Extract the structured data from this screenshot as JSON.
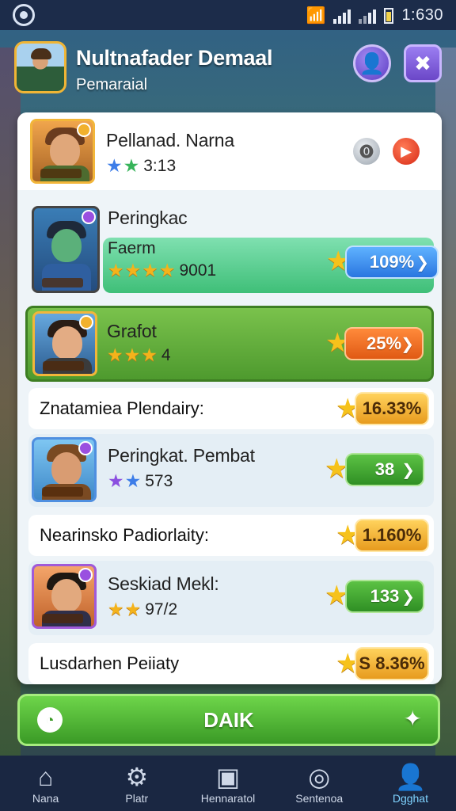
{
  "status": {
    "time": "1:630"
  },
  "header": {
    "title": "Nultnafader Demaal",
    "subtitle": "Pemaraial"
  },
  "top_card": {
    "name": "Pellanad. Narna",
    "score": "3:13"
  },
  "section": {
    "heading": "Peringkac",
    "name": "Faerm",
    "score": "9001",
    "pill": "109%"
  },
  "rows": [
    {
      "name": "Grafot",
      "score": "4",
      "pill": "25%"
    },
    {
      "name": "Peringkat. Pembat",
      "score": "573",
      "pill": "38"
    },
    {
      "name": "Seskiad Mekl:",
      "score": "97/2",
      "pill": "133"
    }
  ],
  "summaries": [
    {
      "label": "Znatamiea Plendairy:",
      "value": "16.33%"
    },
    {
      "label": "Nearinsko Padiorlaity:",
      "value": "1.160%"
    },
    {
      "label": "Lusdarhen Peiiaty",
      "value": "S 8.36%"
    }
  ],
  "main_button": {
    "label": "DAIK"
  },
  "nav": [
    {
      "label": "Nana",
      "icon": "home-icon"
    },
    {
      "label": "Platr",
      "icon": "gear-icon"
    },
    {
      "label": "Hennaratol",
      "icon": "cards-icon"
    },
    {
      "label": "Sentenoa",
      "icon": "settings-icon"
    },
    {
      "label": "Dgghat",
      "icon": "profile-icon"
    }
  ]
}
